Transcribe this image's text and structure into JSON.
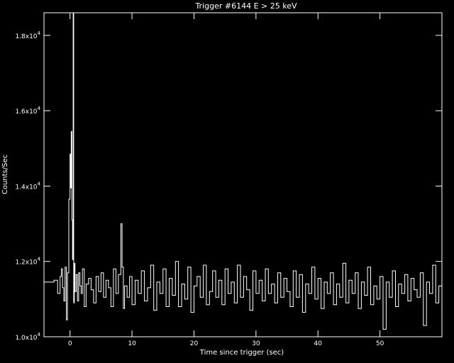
{
  "chart_data": {
    "type": "line",
    "title": "Trigger #6144 E > 25 keV",
    "xlabel": "Time since trigger (sec)",
    "ylabel": "Counts/Sec",
    "xlim": [
      -4.2,
      60
    ],
    "ylim": [
      10000,
      18600
    ],
    "x_ticks": [
      0,
      10,
      20,
      30,
      40,
      50
    ],
    "x_tick_labels": [
      "0",
      "10",
      "20",
      "30",
      "40",
      "50"
    ],
    "y_ticks": [
      10000,
      12000,
      14000,
      16000,
      18000
    ],
    "y_tick_labels": [
      {
        "mantissa": "1.0x10",
        "exp": "4"
      },
      {
        "mantissa": "1.2x10",
        "exp": "4"
      },
      {
        "mantissa": "1.4x10",
        "exp": "4"
      },
      {
        "mantissa": "1.6x10",
        "exp": "4"
      },
      {
        "mantissa": "1.8x10",
        "exp": "4"
      }
    ],
    "grid": false,
    "style": {
      "background": "#000000",
      "line": "#ffffff",
      "axes": "#ffffff"
    },
    "series": [
      {
        "step": true,
        "x": [
          -4.2,
          -2.6,
          -2.0,
          -1.6,
          -1.4,
          -1.2,
          -1.0,
          -0.8,
          -0.6,
          -0.4,
          -0.2,
          0.0,
          0.1,
          0.2,
          0.3,
          0.4,
          0.5,
          0.6,
          0.7,
          0.8,
          1.0,
          1.2,
          1.4,
          1.6,
          1.8,
          2.0,
          2.3,
          2.6,
          3.0,
          3.4,
          3.8,
          4.2,
          4.6,
          5.0,
          5.4,
          5.8,
          6.2,
          6.6,
          7.0,
          7.4,
          7.8,
          8.2,
          8.4,
          8.6,
          8.8,
          9.2,
          9.6,
          10.0,
          10.5,
          11.0,
          11.5,
          12.0,
          12.5,
          13.0,
          13.5,
          14.0,
          14.5,
          15.0,
          15.5,
          16.0,
          16.5,
          17.0,
          17.5,
          18.0,
          18.5,
          19.0,
          19.5,
          20.0,
          20.5,
          21.0,
          21.5,
          22.0,
          22.5,
          23.0,
          23.5,
          24.0,
          24.5,
          25.0,
          25.5,
          26.0,
          26.5,
          27.0,
          27.5,
          28.0,
          28.5,
          29.0,
          29.5,
          30.0,
          30.5,
          31.0,
          31.5,
          32.0,
          32.5,
          33.0,
          33.5,
          34.0,
          34.5,
          35.0,
          35.5,
          36.0,
          36.5,
          37.0,
          37.5,
          38.0,
          38.5,
          39.0,
          39.5,
          40.0,
          40.5,
          41.0,
          41.5,
          42.0,
          42.5,
          43.0,
          43.5,
          44.0,
          44.5,
          45.0,
          45.5,
          46.0,
          46.5,
          47.0,
          47.5,
          48.0,
          48.5,
          49.0,
          49.5,
          50.0,
          50.5,
          51.0,
          51.5,
          52.0,
          52.5,
          53.0,
          53.5,
          54.0,
          54.5,
          55.0,
          55.5,
          56.0,
          56.5,
          57.0,
          57.5,
          58.0,
          58.5,
          59.0,
          59.5,
          60.0
        ],
        "y": [
          11450,
          11500,
          11150,
          11600,
          11800,
          11300,
          10950,
          11850,
          10450,
          11700,
          13650,
          14850,
          13950,
          15450,
          13100,
          12050,
          18600,
          10900,
          11950,
          11200,
          11650,
          10950,
          11700,
          11350,
          11150,
          11800,
          10800,
          11400,
          11550,
          11250,
          10900,
          11600,
          11200,
          11700,
          11050,
          11500,
          11300,
          10800,
          11800,
          11150,
          11650,
          13000,
          11850,
          10750,
          11350,
          11050,
          11600,
          10850,
          11500,
          11150,
          11750,
          10950,
          11300,
          11900,
          10700,
          11450,
          11150,
          11800,
          10800,
          11550,
          11100,
          12000,
          10800,
          11400,
          11000,
          11850,
          10650,
          11350,
          11600,
          11050,
          11900,
          10850,
          11200,
          11750,
          11050,
          11500,
          10850,
          11800,
          11150,
          11450,
          10900,
          11900,
          11050,
          11600,
          11250,
          10700,
          11750,
          11150,
          11500,
          10950,
          11800,
          11150,
          11400,
          10900,
          11700,
          11050,
          11550,
          11200,
          10800,
          11750,
          11050,
          11650,
          10650,
          11400,
          11150,
          11850,
          11000,
          11550,
          10750,
          11450,
          11150,
          11700,
          10850,
          11400,
          11050,
          11950,
          10900,
          11500,
          11150,
          11700,
          10750,
          11450,
          11100,
          11850,
          10850,
          11350,
          11000,
          11600,
          10200,
          11450,
          11050,
          11750,
          10800,
          11400,
          11150,
          11650,
          10950,
          11550,
          11250,
          11050,
          11700,
          10300,
          11450,
          11150,
          11900,
          10900,
          11350,
          11600
        ]
      }
    ]
  }
}
